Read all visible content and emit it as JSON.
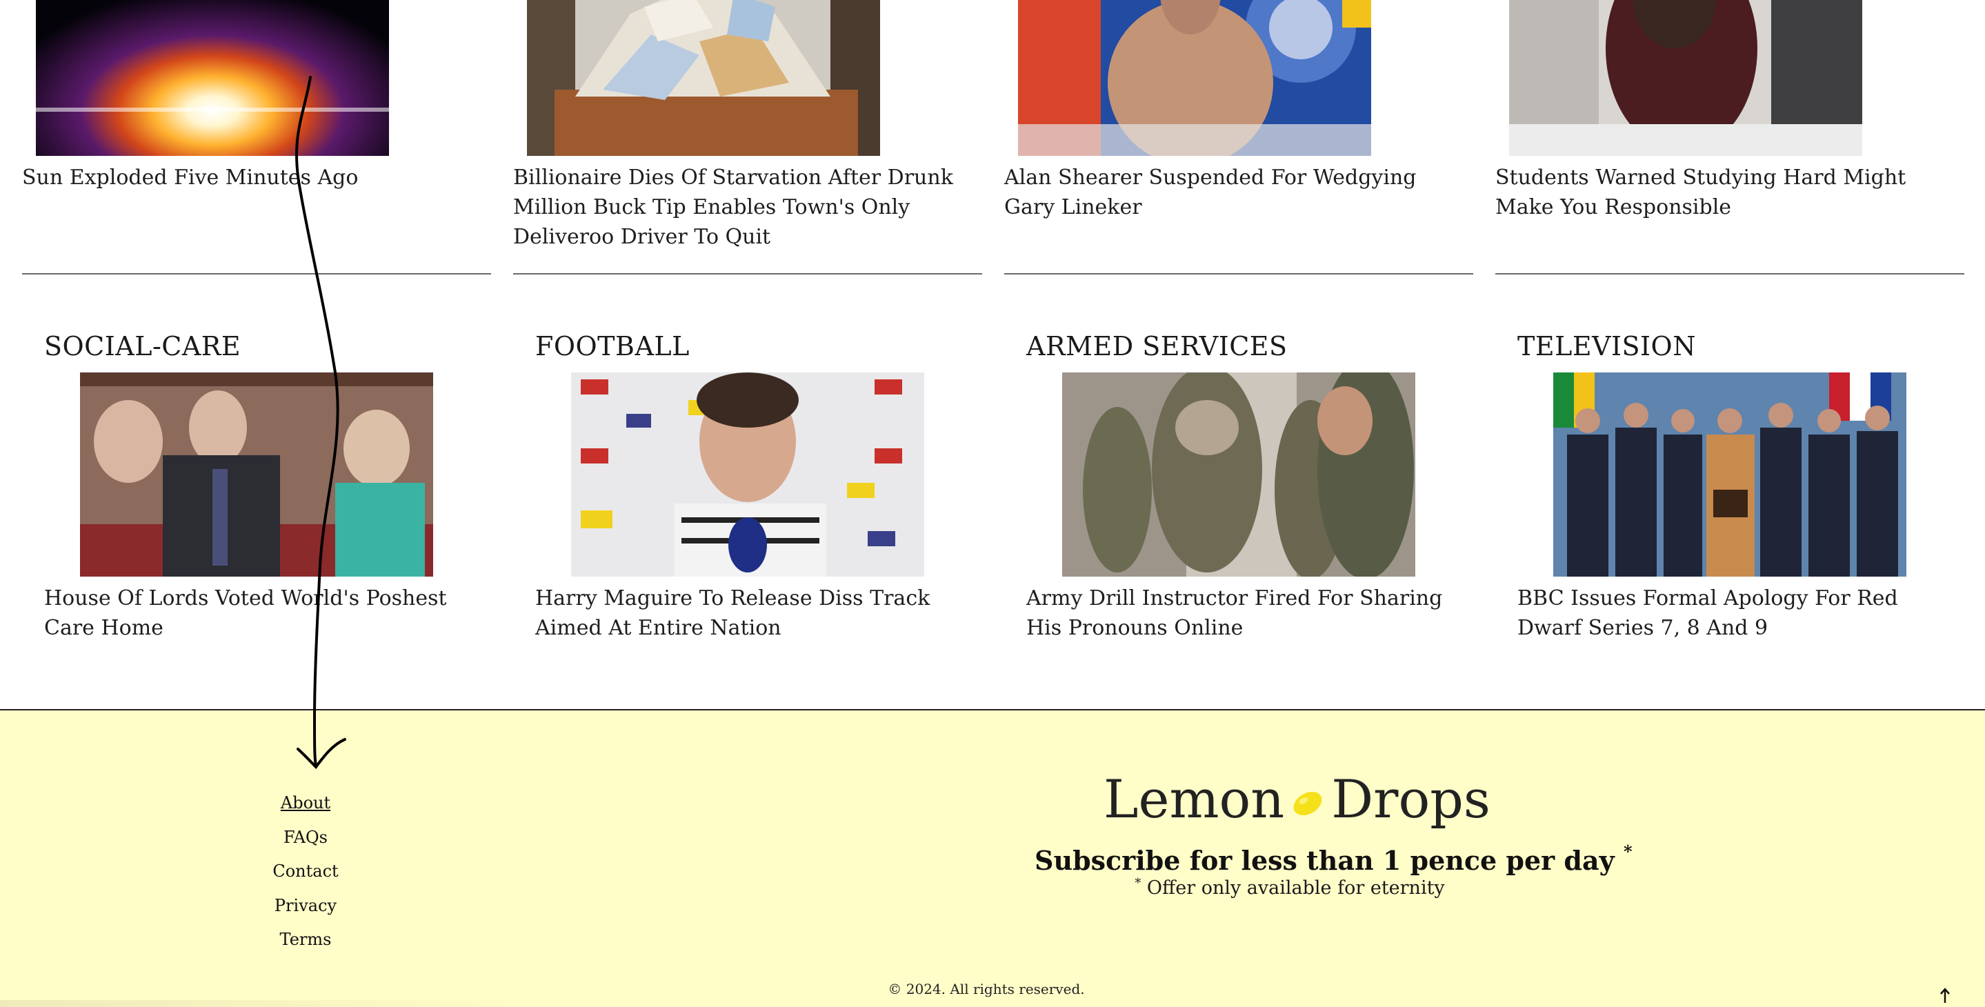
{
  "row1": [
    {
      "headline": "Sun Exploded Five Minutes Ago",
      "image": "exploding-sun-image"
    },
    {
      "headline": "Billionaire Dies Of Starvation After Drunk Million Buck Tip Enables Town's Only Deliveroo Driver To Quit",
      "image": "letters-pile-image"
    },
    {
      "headline": "Alan Shearer Suspended For Wedgying Gary Lineker",
      "image": "studio-pundit-image"
    },
    {
      "headline": "Students Warned Studying Hard Might Make You Responsible",
      "image": "stressed-student-image"
    }
  ],
  "row2": [
    {
      "section": "SOCIAL-CARE",
      "headline": "House Of Lords Voted World's Poshest Care Home",
      "image": "house-of-lords-image"
    },
    {
      "section": "FOOTBALL",
      "headline": "Harry Maguire To Release Diss Track Aimed At Entire Nation",
      "image": "footballer-interview-image"
    },
    {
      "section": "ARMED SERVICES",
      "headline": "Army Drill Instructor Fired For Sharing His Pronouns Online",
      "image": "drill-instructor-image"
    },
    {
      "section": "TELEVISION",
      "headline": "BBC Issues Formal Apology For Red Dwarf Series 7, 8 And 9",
      "image": "un-delegates-image"
    }
  ],
  "footer": {
    "links": [
      "About",
      "FAQs",
      "Contact",
      "Privacy",
      "Terms"
    ],
    "brand_left": "Lemon",
    "brand_right": "Drops",
    "subscribe": "Subscribe for less than 1 pence per day",
    "subscribe_mark": "*",
    "offer_mark": "*",
    "offer": "Offer only available for eternity",
    "copyright": "© 2024. All rights reserved.",
    "to_top_icon": "arrow-up-icon"
  },
  "colors": {
    "footer_bg": "#fffdc8",
    "lemon": "#f5e11a",
    "divider": "#6a6a6a"
  }
}
